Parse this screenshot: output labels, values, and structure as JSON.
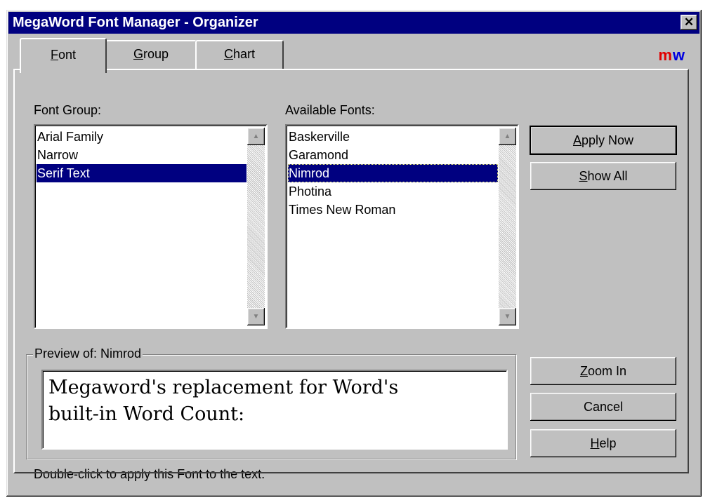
{
  "window": {
    "title": "MegaWord Font Manager - Organizer",
    "close_glyph": "✕"
  },
  "tabs": [
    {
      "label_pre": "",
      "label_key": "F",
      "label_post": "ont",
      "active": true
    },
    {
      "label_pre": "",
      "label_key": "G",
      "label_post": "roup",
      "active": false
    },
    {
      "label_pre": "",
      "label_key": "C",
      "label_post": "hart",
      "active": false
    }
  ],
  "logo": {
    "m": "m",
    "w": "w"
  },
  "font_group": {
    "label": "Font Group:",
    "items": [
      "Arial Family",
      "Narrow",
      "Serif Text"
    ],
    "selected_index": 2
  },
  "available_fonts": {
    "label": "Available Fonts:",
    "items": [
      "Baskerville",
      "Garamond",
      "Nimrod",
      "Photina",
      "Times New Roman"
    ],
    "selected_index": 2
  },
  "buttons": {
    "apply_now": {
      "pre": "",
      "key": "A",
      "post": "pply Now"
    },
    "show_all": {
      "pre": "",
      "key": "S",
      "post": "how All"
    },
    "zoom_in": {
      "pre": "",
      "key": "Z",
      "post": "oom In"
    },
    "cancel": {
      "label": "Cancel"
    },
    "help": {
      "pre": "",
      "key": "H",
      "post": "elp"
    }
  },
  "preview": {
    "legend": "Preview of: Nimrod",
    "text_line1": "Megaword's replacement for Word's",
    "text_line2": "built-in Word Count:"
  },
  "status": {
    "text": "Double-click to apply this Font to the text."
  },
  "icons": {
    "scroll_up": "scroll-up-arrow-icon",
    "scroll_down": "scroll-down-arrow-icon",
    "close": "close-icon"
  },
  "colors": {
    "title_bar": "#000080",
    "selection": "#000080",
    "face": "#c0c0c0",
    "logo_m": "#e00000",
    "logo_w": "#0000e0"
  }
}
